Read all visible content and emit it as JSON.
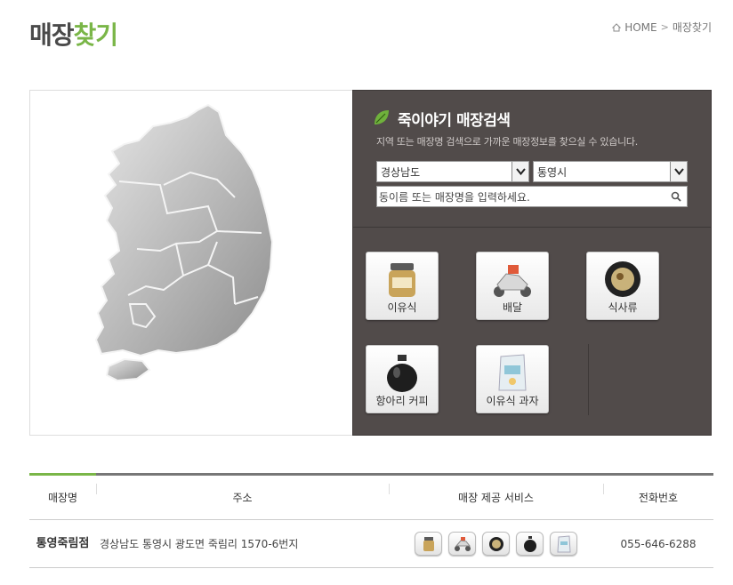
{
  "header": {
    "title_part1": "매장",
    "title_part2": "찾기",
    "breadcrumb": {
      "home": "HOME",
      "current": "매장찾기"
    }
  },
  "search": {
    "title": "죽이야기 매장검색",
    "description": "지역 또는 매장명 검색으로 가까운 매장정보를 찾으실 수 있습니다.",
    "province_selected": "경상남도",
    "city_selected": "통영시",
    "keyword_placeholder": "동이름 또는 매장명을 입력하세요."
  },
  "services": [
    {
      "label": "이유식",
      "icon": "baby-food-jar-icon"
    },
    {
      "label": "배달",
      "icon": "delivery-scooter-icon"
    },
    {
      "label": "식사류",
      "icon": "meal-bowl-icon"
    },
    {
      "label": "항아리 커피",
      "icon": "coffee-jar-icon"
    },
    {
      "label": "이유식 과자",
      "icon": "baby-snack-bag-icon"
    }
  ],
  "table": {
    "headers": [
      "매장명",
      "주소",
      "매장 제공 서비스",
      "전화번호"
    ],
    "rows": [
      {
        "name": "통영죽림점",
        "address": "경상남도 통영시 광도면 죽림리 1570-6번지",
        "phone": "055-646-6288"
      }
    ]
  },
  "colors": {
    "accent_green": "#7ab648",
    "panel_bg": "#514b4a"
  }
}
